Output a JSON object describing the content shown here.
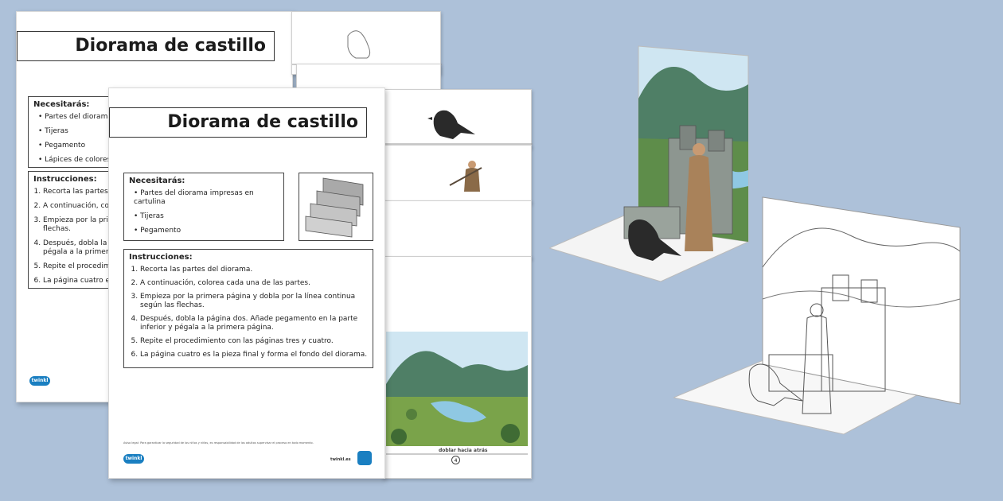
{
  "back_sheet": {
    "title": "Diorama de castillo",
    "needs_heading": "Necesitarás:",
    "needs": [
      "Partes del diorama",
      "Tijeras",
      "Pegamento",
      "Lápices de colores"
    ],
    "instructions_heading": "Instrucciones:",
    "instructions": [
      "Recorta las partes d",
      "A continuación, colo",
      "Empieza por la prim las flechas.",
      "Después, dobla la p pégala a la primera",
      "Repite el procedimie",
      "La página cuatro es"
    ],
    "logo": "twinkl"
  },
  "front_sheet": {
    "title": "Diorama de castillo",
    "needs_heading": "Necesitarás:",
    "needs": [
      "Partes del diorama impresas en cartulina",
      "Tijeras",
      "Pegamento"
    ],
    "instructions_heading": "Instrucciones:",
    "instructions": [
      "Recorta las partes del diorama.",
      "A continuación, colorea cada una de las partes.",
      "Empieza por la primera página y dobla por la línea continua según las flechas.",
      "Después, dobla la página dos. Añade pegamento en la parte inferior y pégala a la primera página.",
      "Repite el procedimiento con las páginas tres y cuatro.",
      "La página cuatro es la pieza final y forma el fondo del diorama."
    ],
    "legal": "Aviso legal: Para garantizar la seguridad de los niños y niñas, es responsabilidad de los adultos supervisar el proceso en todo momento.",
    "logo": "twinkl",
    "url": "twinkl.es"
  },
  "right_page": {
    "fold_label": "doblar hacia atrás",
    "page_number": "4"
  },
  "colors": {
    "background": "#adc1d9",
    "paper": "#ffffff",
    "sky": "#cfe6f2",
    "mountain": "#4f7f66",
    "grass": "#7aa34a",
    "water": "#8fc8e3",
    "stone": "#8d9690",
    "brand": "#1a7fc1"
  }
}
